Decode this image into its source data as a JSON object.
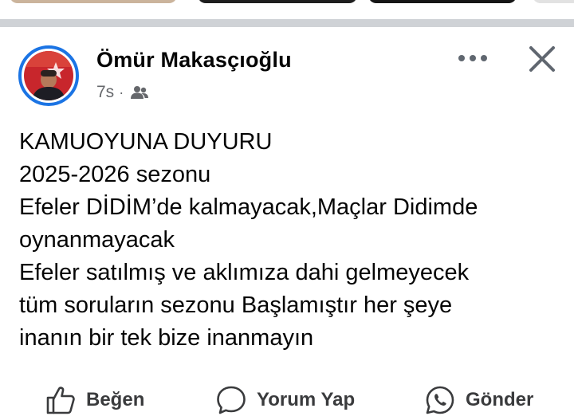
{
  "post": {
    "author": "Ömür Makasçıoğlu",
    "timestamp": "7s",
    "meta_separator": "·",
    "audience_icon": "friends-icon",
    "lines": [
      "KAMUOYUNA DUYURU",
      "2025-2026 sezonu",
      "Efeler DİDİM’de  kalmayacak,Maçlar Didimde",
      "oynanmayacak",
      "Efeler satılmış ve aklımıza dahi gelmeyecek",
      "tüm  soruların sezonu Başlamıştır her şeye",
      "inanın bir tek bize inanmayın"
    ]
  },
  "actions": {
    "like_label": "Beğen",
    "comment_label": "Yorum Yap",
    "share_label": "Gönder"
  },
  "icons": {
    "more": "more-dots-icon",
    "close": "close-icon",
    "like": "thumbs-up-icon",
    "comment": "comment-bubble-icon",
    "share": "whatsapp-icon"
  },
  "colors": {
    "accent": "#1b74e4",
    "text": "#050505",
    "secondary_text": "#65676b",
    "separator": "#cfd2d6"
  }
}
